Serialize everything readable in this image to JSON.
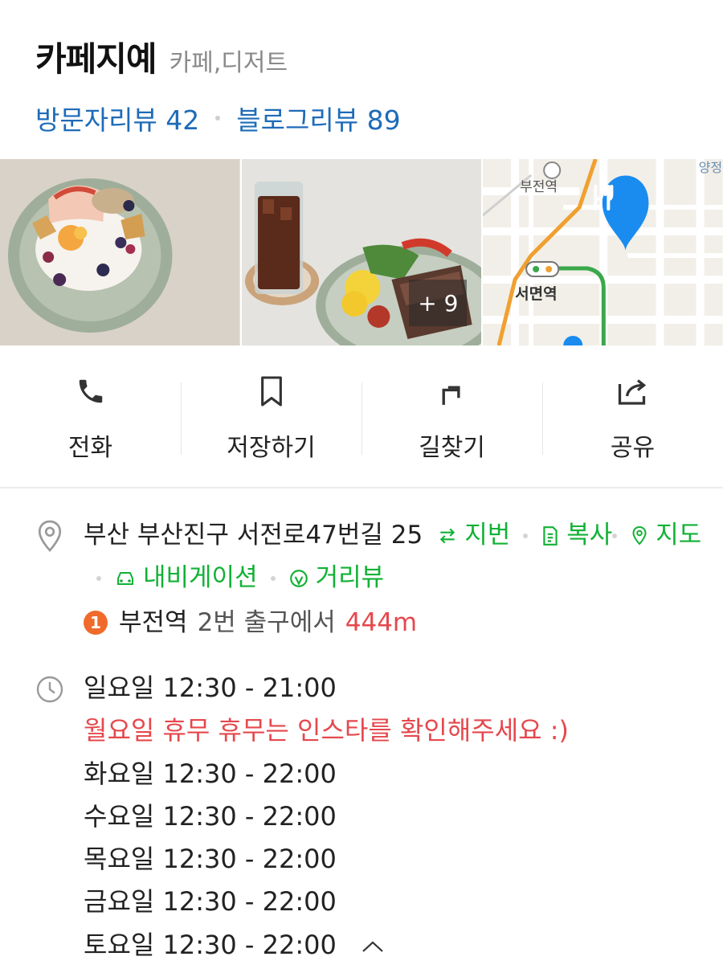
{
  "place": {
    "name": "카페지예",
    "category": "카페,디저트"
  },
  "reviews": {
    "visitor_label": "방문자리뷰 42",
    "blog_label": "블로그리뷰 89"
  },
  "photos": {
    "more_count": "+ 9",
    "map_station_label": "부전역",
    "map_station2_label": "서면역",
    "map_corner_label": "양정"
  },
  "actions": [
    {
      "label": "전화",
      "icon": "phone-icon"
    },
    {
      "label": "저장하기",
      "icon": "bookmark-icon"
    },
    {
      "label": "길찾기",
      "icon": "directions-icon"
    },
    {
      "label": "공유",
      "icon": "share-icon"
    }
  ],
  "address": {
    "text": "부산 부산진구 서전로47번길 25",
    "jibun_label": "지번",
    "copy_label": "복사",
    "map_label": "지도",
    "navi_label": "내비게이션",
    "street_label": "거리뷰"
  },
  "subway": {
    "line_number": "1",
    "line_color": "#f06a2b",
    "station": "부전역",
    "exit": "2번 출구에서",
    "distance": "444m"
  },
  "hours": [
    {
      "text": "일요일 12:30 - 21:00",
      "closed": false
    },
    {
      "text": "월요일 휴무 휴무는 인스타를 확인해주세요 :)",
      "closed": true
    },
    {
      "text": "화요일 12:30 - 22:00",
      "closed": false
    },
    {
      "text": "수요일 12:30 - 22:00",
      "closed": false
    },
    {
      "text": "목요일 12:30 - 22:00",
      "closed": false
    },
    {
      "text": "금요일 12:30 - 22:00",
      "closed": false
    },
    {
      "text": "토요일 12:30 - 22:00",
      "closed": false
    }
  ],
  "colors": {
    "link_blue": "#1e6bb8",
    "action_green": "#12b136",
    "alert_red": "#e5484d",
    "map_pin_blue": "#1a8cf0"
  }
}
